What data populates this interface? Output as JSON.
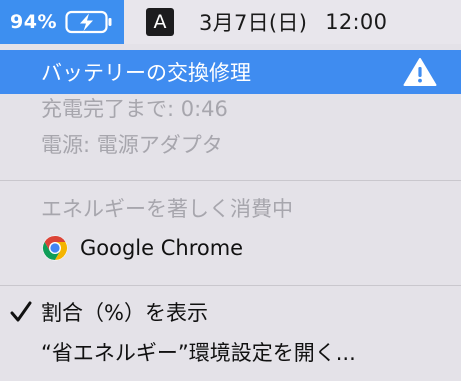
{
  "menubar": {
    "battery_percent": "94%",
    "battery_icon": "battery-charging-icon",
    "input_source": "A",
    "date": "3月7日(日)",
    "time": "12:00"
  },
  "menu": {
    "service_item": {
      "label": "バッテリーの交換修理",
      "icon": "warning-icon"
    },
    "time_to_full": "充電完了まで: 0:46",
    "power_source": "電源: 電源アダプタ",
    "energy_header": "エネルギーを著しく消費中",
    "energy_apps": [
      {
        "name": "Google Chrome",
        "icon": "chrome-icon"
      }
    ],
    "show_percentage": {
      "label": "割合（%）を表示",
      "checked": true
    },
    "open_energy_saver": "“省エネルギー”環境設定を開く..."
  },
  "colors": {
    "accent": "#3f8cf0",
    "menu_background": "#e4e2e8",
    "disabled_text": "#a7a6ad"
  }
}
